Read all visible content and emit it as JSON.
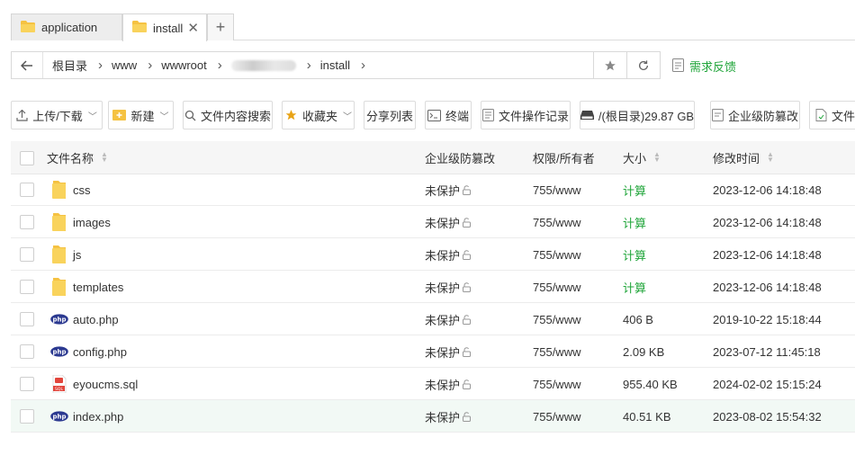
{
  "tabs": [
    {
      "label": "application",
      "icon": "folder-icon"
    },
    {
      "label": "install",
      "icon": "folder-icon",
      "close": "✕"
    }
  ],
  "add_tab": "+",
  "breadcrumb": [
    "根目录",
    "www",
    "wwwroot",
    "install"
  ],
  "feedback_label": "需求反馈",
  "toolbar": {
    "upload": "上传/下载",
    "new": "新建",
    "search": "文件内容搜索",
    "favorites": "收藏夹",
    "share": "分享列表",
    "terminal": "终端",
    "log": "文件操作记录",
    "disk": "/(根目录)29.87 GB",
    "protect": "企业级防篡改",
    "sync": "文件"
  },
  "columns": {
    "name": "文件名称",
    "protect": "企业级防篡改",
    "perm": "权限/所有者",
    "size": "大小",
    "mtime": "修改时间"
  },
  "files": [
    {
      "name": "css",
      "type": "folder",
      "protect": "未保护",
      "perm": "755/www",
      "size": "计算",
      "mtime": "2023-12-06 14:18:48"
    },
    {
      "name": "images",
      "type": "folder",
      "protect": "未保护",
      "perm": "755/www",
      "size": "计算",
      "mtime": "2023-12-06 14:18:48"
    },
    {
      "name": "js",
      "type": "folder",
      "protect": "未保护",
      "perm": "755/www",
      "size": "计算",
      "mtime": "2023-12-06 14:18:48"
    },
    {
      "name": "templates",
      "type": "folder",
      "protect": "未保护",
      "perm": "755/www",
      "size": "计算",
      "mtime": "2023-12-06 14:18:48"
    },
    {
      "name": "auto.php",
      "type": "php",
      "protect": "未保护",
      "perm": "755/www",
      "size": "406 B",
      "mtime": "2019-10-22 15:18:44"
    },
    {
      "name": "config.php",
      "type": "php",
      "protect": "未保护",
      "perm": "755/www",
      "size": "2.09 KB",
      "mtime": "2023-07-12 11:45:18"
    },
    {
      "name": "eyoucms.sql",
      "type": "sql",
      "protect": "未保护",
      "perm": "755/www",
      "size": "955.40 KB",
      "mtime": "2024-02-02 15:15:24"
    },
    {
      "name": "index.php",
      "type": "php",
      "protect": "未保护",
      "perm": "755/www",
      "size": "40.51 KB",
      "mtime": "2023-08-02 15:54:32"
    }
  ],
  "icon_labels": {
    "php": "php",
    "sql": "SQL"
  },
  "colors": {
    "accent": "#20a53a",
    "folder": "#f5c242",
    "php": "#2b3990",
    "sql": "#e2453c"
  }
}
